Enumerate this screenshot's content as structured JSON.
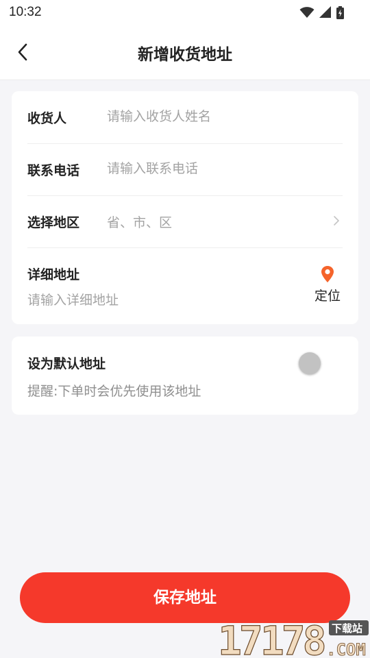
{
  "status_bar": {
    "time": "10:32",
    "icons": [
      "wifi-icon",
      "signal-icon",
      "battery-icon"
    ]
  },
  "header": {
    "title": "新增收货地址",
    "back_icon": "chevron-left-icon"
  },
  "form": {
    "recipient": {
      "label": "收货人",
      "placeholder": "请输入收货人姓名",
      "value": ""
    },
    "phone": {
      "label": "联系电话",
      "placeholder": "请输入联系电话",
      "value": ""
    },
    "region": {
      "label": "选择地区",
      "placeholder": "省、市、区",
      "icon": "chevron-right-icon"
    },
    "detail": {
      "label": "详细地址",
      "placeholder": "请输入详细地址",
      "value": "",
      "locate_label": "定位",
      "locate_icon": "location-pin-icon"
    }
  },
  "default_address": {
    "title": "设为默认地址",
    "hint": "提醒:下单时会优先使用该地址",
    "enabled": false
  },
  "actions": {
    "save_label": "保存地址"
  },
  "watermark": {
    "logo_text": "17178",
    "suffix": ".COM",
    "tag": "下载站"
  },
  "colors": {
    "accent": "#f5392b",
    "locate": "#f5642b",
    "background": "#f5f5f8",
    "toggle_off": "#c2c2c2"
  }
}
